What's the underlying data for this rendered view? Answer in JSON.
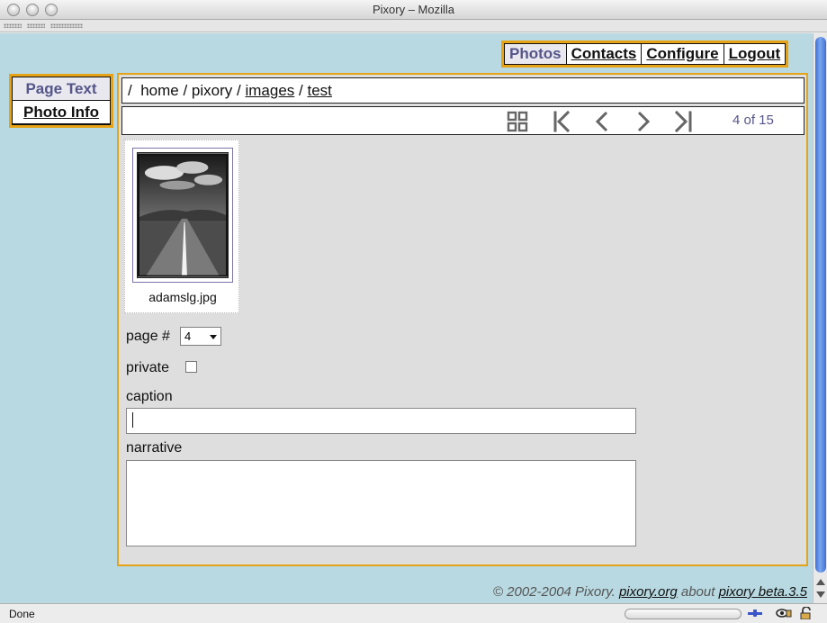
{
  "window": {
    "title": "Pixory – Mozilla"
  },
  "topnav": {
    "photos": "Photos",
    "contacts": "Contacts",
    "configure": "Configure",
    "logout": "Logout"
  },
  "leftnav": {
    "page_text": "Page Text",
    "photo_info": "Photo Info"
  },
  "breadcrumb": {
    "root": "/",
    "home": "home",
    "sep1": "/",
    "pixory": "pixory",
    "sep2": "/",
    "images": "images",
    "sep3": "/",
    "test": "test"
  },
  "toolbar": {
    "icons": [
      "grid-view-icon",
      "first-page-icon",
      "previous-icon",
      "next-icon",
      "last-page-icon"
    ],
    "counter": "4 of 15"
  },
  "photo": {
    "filename": "adamslg.jpg"
  },
  "form": {
    "page_label": "page #",
    "page_value": "4",
    "private_label": "private",
    "private_checked": false,
    "caption_label": "caption",
    "caption_value": "",
    "narrative_label": "narrative",
    "narrative_value": ""
  },
  "footer": {
    "copyright": "© 2002-2004 Pixory.",
    "site_link": "pixory.org",
    "about": "about",
    "version_link": "pixory beta.3.5"
  },
  "status": {
    "text": "Done"
  },
  "colors": {
    "accent": "#e6a317",
    "background": "#b8d9e1",
    "active_tab_text": "#55558a",
    "panel": "#dedede"
  }
}
